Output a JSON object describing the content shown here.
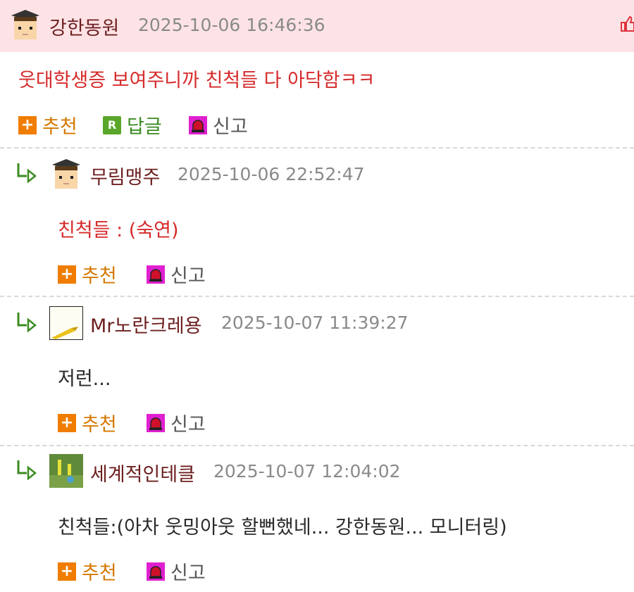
{
  "colors": {
    "header_bg": "#fde3e6",
    "author": "#6d1f1f",
    "highlight_text": "#d62b2b",
    "recommend": "#d47800",
    "reply": "#3c8b22",
    "report": "#e020d0"
  },
  "actions": {
    "recommend": "추천",
    "reply": "답글",
    "report": "신고",
    "reply_icon_letter": "R"
  },
  "comments": [
    {
      "author": "강한동원",
      "date": "2025-10-06 16:46:36",
      "text": "웃대학생증 보여주니까 친척들 다 아닥함ㅋㅋ",
      "avatar": "student-avatar-icon"
    },
    {
      "author": "무림맹주",
      "date": "2025-10-06 22:52:47",
      "text": "친척들 : (숙연)",
      "avatar": "student-avatar-icon"
    },
    {
      "author": "Mr노란크레용",
      "date": "2025-10-07 11:39:27",
      "text": "저런...",
      "avatar": "crayon-avatar-icon"
    },
    {
      "author": "세계적인테클",
      "date": "2025-10-07 12:04:02",
      "text": "친척들:(아차 웃밍아웃 할뻔했네... 강한동원... 모니터링)",
      "avatar": "photo-avatar-icon"
    }
  ]
}
